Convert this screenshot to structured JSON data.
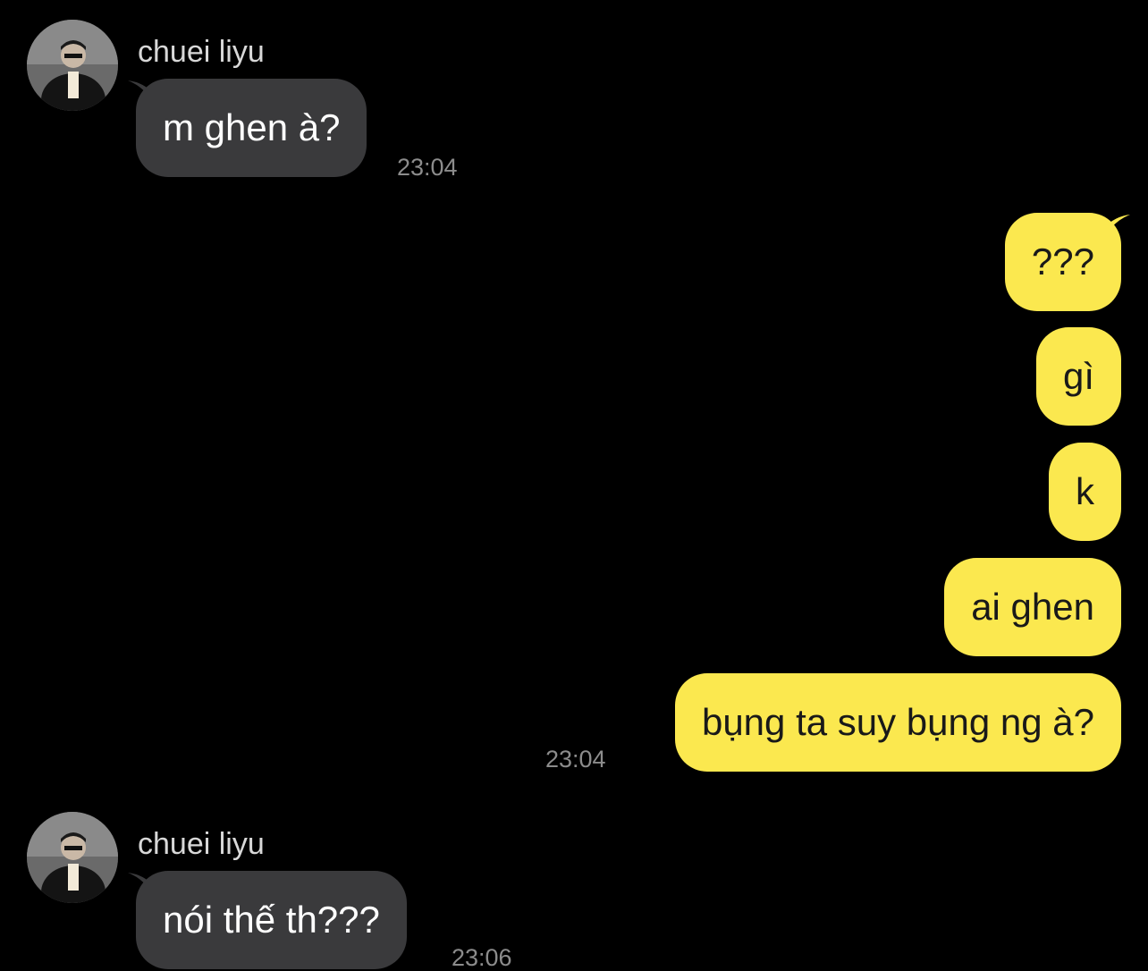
{
  "messages": [
    {
      "sender": "chuei liyu",
      "text": "m ghen à?",
      "time": "23:04"
    },
    {
      "text": "???"
    },
    {
      "text": "gì"
    },
    {
      "text": "k"
    },
    {
      "text": "ai ghen"
    },
    {
      "text": "bụng ta suy bụng ng à?",
      "time": "23:04"
    },
    {
      "sender": "chuei liyu",
      "text": "nói thế th???",
      "time": "23:06"
    }
  ],
  "colors": {
    "background": "#000000",
    "incoming_bubble": "#3a3a3c",
    "outgoing_bubble": "#fbe84f",
    "timestamp": "#8c8c8c"
  },
  "icons": {
    "avatar": "profile-photo"
  }
}
